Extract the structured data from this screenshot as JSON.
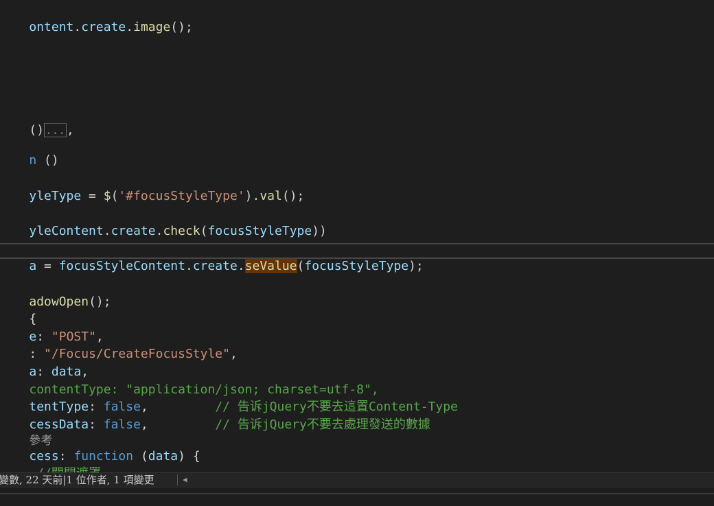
{
  "code_lines": {
    "l1": [
      "ontent",
      ".",
      "create",
      ".",
      "image",
      "();"
    ],
    "l2": [
      "()",
      "...",
      ","
    ],
    "l3": [
      "n",
      " ()"
    ],
    "l4": [
      "yleType",
      " = ",
      "$",
      "(",
      "'#focusStyleType'",
      ").",
      "val",
      "();"
    ],
    "l5": [
      "yleContent",
      ".",
      "create",
      ".",
      "check",
      "(",
      "focusStyleType",
      "))"
    ],
    "l6": [
      "a",
      " = ",
      "focusStyleContent",
      ".",
      "create",
      ".",
      "seValue",
      "(",
      "focusStyleType",
      ");"
    ],
    "l7": [
      "adowOpen",
      "();"
    ],
    "l8": [
      "{"
    ],
    "l9": [
      "e",
      ": ",
      "\"POST\"",
      ","
    ],
    "l10": [
      ":",
      " ",
      "\"/Focus/CreateFocusStyle\"",
      ","
    ],
    "l11": [
      "a",
      ": ",
      "data",
      ","
    ],
    "l12": [
      "contentType: \"application/json; charset=utf-8\","
    ],
    "l13": [
      "tentType",
      ": ",
      "false",
      ",",
      "         // 告诉jQuery不要去這置Content-Type"
    ],
    "l14": [
      "cessData",
      ": ",
      "false",
      ",",
      "         // 告诉jQuery不要去處理發送的數據"
    ],
    "l15": [
      "參考"
    ],
    "l16": [
      "cess",
      ": ",
      "function",
      " (",
      "data",
      ") {"
    ],
    "l17": [
      " //關閉遮罩"
    ]
  },
  "codelens": {
    "text": "變數, 22 天前|1 位作者, 1 項變更"
  },
  "colors": {
    "background": "#1e1e1e",
    "identifier": "#9cdcfe",
    "function": "#dcdcaa",
    "string": "#ce9178",
    "keyword": "#569cd6",
    "comment": "#57a64a",
    "highlight": "#653306"
  },
  "icons": {
    "scroll_left": "triangle-left"
  }
}
